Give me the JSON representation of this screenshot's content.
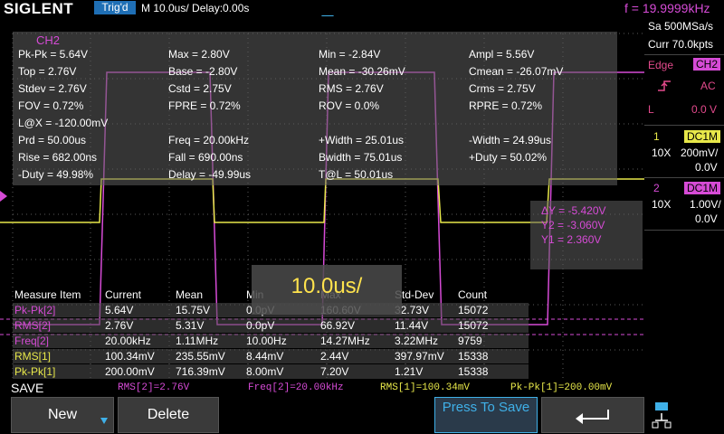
{
  "header": {
    "brand": "SIGLENT",
    "trigger_status": "Trig'd",
    "timebase": "M 10.0us/  Delay:0.00s",
    "trigger_frequency": "f = 19.9999kHz"
  },
  "measurements": {
    "channel_label": "CH2",
    "items": [
      [
        "Pk-Pk = 5.64V",
        "Max = 2.80V",
        "Min = -2.84V",
        "Ampl = 5.56V"
      ],
      [
        "Top = 2.76V",
        "Base = -2.80V",
        "Mean = -30.26mV",
        "Cmean = -26.07mV"
      ],
      [
        "Stdev = 2.76V",
        "Cstd = 2.75V",
        "RMS = 2.76V",
        "Crms = 2.75V"
      ],
      [
        "FOV = 0.72%",
        "FPRE = 0.72%",
        "ROV = 0.0%",
        "RPRE = 0.72%"
      ],
      [
        "L@X = -120.00mV",
        "",
        "",
        ""
      ],
      [
        "Prd = 50.00us",
        "Freq = 20.00kHz",
        "+Width = 25.01us",
        "-Width = 24.99us"
      ],
      [
        "Rise = 682.00ns",
        "Fall = 690.00ns",
        "Bwidth = 75.01us",
        "+Duty = 50.02%"
      ],
      [
        "-Duty = 49.98%",
        "Delay = -49.99us",
        "T@L = 50.01us",
        ""
      ]
    ]
  },
  "cursors": {
    "delta_y": "ΔY = -5.420V",
    "y2": "Y2 = -3.060V",
    "y1": "Y1 = 2.360V"
  },
  "timebase_popup": "10.0us/",
  "stats_table": {
    "headers": [
      "Measure Item",
      "Current",
      "Mean",
      "Min",
      "Max",
      "Std-Dev",
      "Count"
    ],
    "rows": [
      {
        "item": "Pk-Pk[2]",
        "current": "5.64V",
        "mean": "15.75V",
        "min": "0.0pV",
        "max": "160.60V",
        "std": "32.73V",
        "count": "15072",
        "color": "#d64bd6"
      },
      {
        "item": "RMS[2]",
        "current": "2.76V",
        "mean": "5.31V",
        "min": "0.0pV",
        "max": "66.92V",
        "std": "11.44V",
        "count": "15072",
        "color": "#d64bd6"
      },
      {
        "item": "Freq[2]",
        "current": "20.00kHz",
        "mean": "1.11MHz",
        "min": "10.00Hz",
        "max": "14.27MHz",
        "std": "3.22MHz",
        "count": "9759",
        "color": "#d64bd6"
      },
      {
        "item": "RMS[1]",
        "current": "100.34mV",
        "mean": "235.55mV",
        "min": "8.44mV",
        "max": "2.44V",
        "std": "397.97mV",
        "count": "15338",
        "color": "#e8e84a"
      },
      {
        "item": "Pk-Pk[1]",
        "current": "200.00mV",
        "mean": "716.39mV",
        "min": "8.00mV",
        "max": "7.20V",
        "std": "1.21V",
        "count": "15338",
        "color": "#e8e84a"
      }
    ]
  },
  "right_panel": {
    "sample_rate": "Sa 500MSa/s",
    "mem_depth": "Curr 70.0kpts",
    "trigger_type": "Edge",
    "trigger_source": "CH2",
    "coupling": "AC",
    "level_label": "L",
    "level_value": "0.0 V",
    "ch1": {
      "num": "1",
      "coupling": "DC1M",
      "probe": "10X",
      "scale": "200mV/",
      "offset": "0.0V"
    },
    "ch2": {
      "num": "2",
      "coupling": "DC1M",
      "probe": "10X",
      "scale": "1.00V/",
      "offset": "0.0V"
    }
  },
  "bottom_measurements": [
    {
      "text": "RMS[2]=2.76V",
      "color": "#d64bd6"
    },
    {
      "text": "Freq[2]=20.00kHz",
      "color": "#d64bd6"
    },
    {
      "text": "RMS[1]=100.34mV",
      "color": "#e8e84a"
    },
    {
      "text": "Pk-Pk[1]=200.00mV",
      "color": "#e8e84a"
    }
  ],
  "menu": {
    "title": "SAVE",
    "new_label": "New",
    "delete_label": "Delete",
    "press_to_save_label": "Press To Save"
  },
  "colors": {
    "ch1": "#e8e84a",
    "ch2": "#d64bd6",
    "accent_blue": "#1f6fb5",
    "softkey_cyan": "#3fb0e8"
  },
  "icons": [
    "back-arrow-icon",
    "usb-network-icon",
    "down-arrow-icon",
    "rising-edge-icon"
  ]
}
